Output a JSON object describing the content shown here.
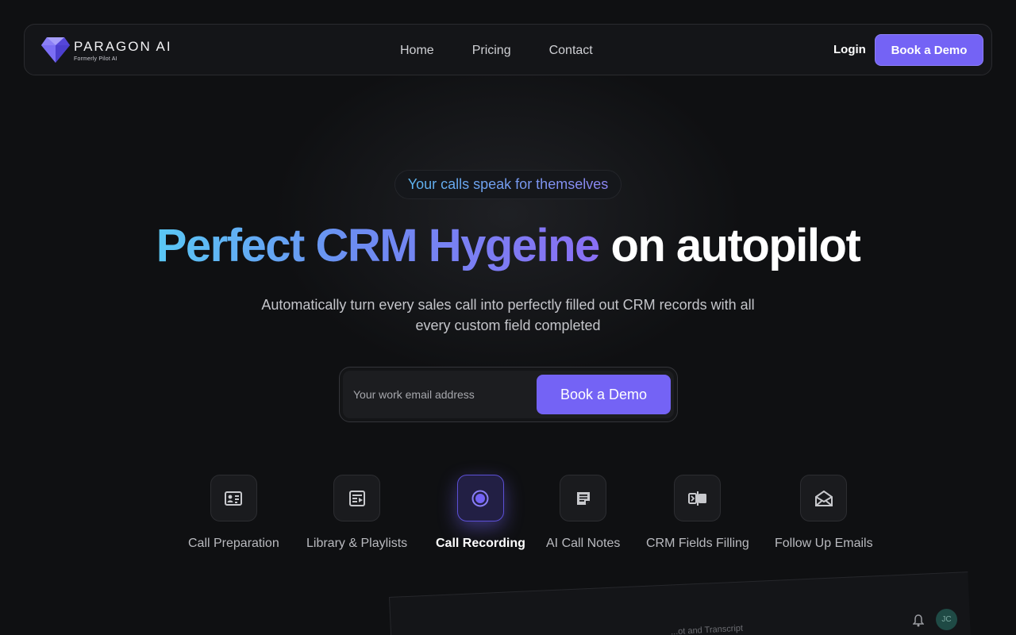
{
  "brand": {
    "name": "PARAGON AI",
    "subtitle": "Formerly Pilot AI"
  },
  "nav": {
    "links": [
      "Home",
      "Pricing",
      "Contact"
    ],
    "login_label": "Login",
    "cta_label": "Book a Demo"
  },
  "hero": {
    "pill": "Your calls speak for themselves",
    "headline_gradient": "Perfect CRM Hygeine",
    "headline_plain": "on autopilot",
    "subtext": "Automatically turn every sales call into perfectly filled out CRM records with all every custom field completed"
  },
  "form": {
    "email_placeholder": "Your work email address",
    "email_value": "",
    "submit_label": "Book a Demo"
  },
  "features": [
    {
      "label": "Call Preparation",
      "icon": "contact-card-icon",
      "active": false
    },
    {
      "label": "Library & Playlists",
      "icon": "playlist-icon",
      "active": false
    },
    {
      "label": "Call Recording",
      "icon": "record-icon",
      "active": true
    },
    {
      "label": "AI Call Notes",
      "icon": "notes-icon",
      "active": false
    },
    {
      "label": "CRM Fields Filling",
      "icon": "crm-fields-icon",
      "active": false
    },
    {
      "label": "Follow Up Emails",
      "icon": "email-icon",
      "active": false
    }
  ],
  "preview": {
    "caption": "...ot and Transcript",
    "avatar_initials": "JC"
  },
  "colors": {
    "accent": "#7463f5",
    "background": "#0f1012",
    "gradient_start": "#5ac8f5",
    "gradient_end": "#8a70f4"
  }
}
